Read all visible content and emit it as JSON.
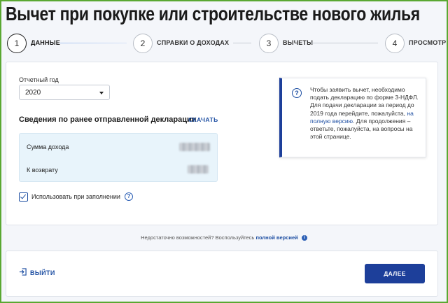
{
  "page": {
    "title": "Вычет при покупке или строительстве нового жилья"
  },
  "stepper": {
    "steps": [
      {
        "number": "1",
        "label": "ДАННЫЕ"
      },
      {
        "number": "2",
        "label": "СПРАВКИ О ДОХОДАХ"
      },
      {
        "number": "3",
        "label": "ВЫЧЕТЫ"
      },
      {
        "number": "4",
        "label": "ПРОСМОТР"
      }
    ],
    "active_step": 1
  },
  "form": {
    "year_label": "Отчетный год",
    "year_value": "2020",
    "prev_declaration_title": "Сведения по ранее отправленной декларации",
    "download_label": "СКАЧАТЬ",
    "income_label": "Сумма дохода",
    "refund_label": "К возврату",
    "use_checkbox_label": "Использовать при заполнении",
    "use_checkbox_checked": true,
    "help_icon_glyph": "?"
  },
  "notice": {
    "icon_glyph": "?",
    "text_before_link": "Чтобы заявить вычет, необходимо подать декларацию по форме 3-НДФЛ. Для подачи декларации за период до 2019 года перейдите, пожалуйста,",
    "link_text": "на полную версию",
    "text_after_link": ". Для продолжения – ответьте, пожалуйста, на вопросы на этой странице.",
    "accent_color": "#1d3f9a"
  },
  "footer": {
    "note_text": "Недостаточно возможностей? Воспользуйтесь",
    "note_link": "полной версией",
    "info_glyph": "i",
    "exit_label": "ВЫЙТИ",
    "next_label": "ДАЛЕЕ",
    "next_button_color": "#1d3f9a"
  }
}
